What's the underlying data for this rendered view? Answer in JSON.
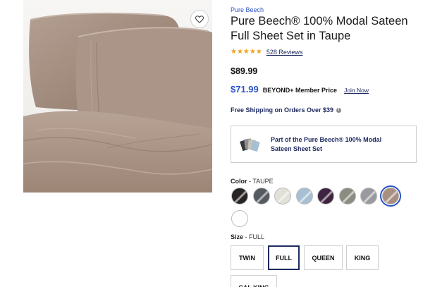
{
  "product": {
    "brand": "Pure Beech",
    "title": "Pure Beech® 100% Modal Sateen Full Sheet Set in Taupe",
    "rating_stars": "★★★★★",
    "rating_value": 4.5,
    "reviews_text": "528 Reviews",
    "price": "$89.99",
    "member_price": "$71.99",
    "member_label": "BEYOND+ Member Price",
    "join_label": "Join Now",
    "shipping_text": "Free Shipping on Orders Over $39",
    "info_icon": "i"
  },
  "set_card": {
    "text": "Part of the Pure Beech® 100% Modal Sateen Sheet Set",
    "icon": "sheet-set-thumbnail-icon"
  },
  "favorite": {
    "icon": "heart-icon"
  },
  "color_option": {
    "label": "Color",
    "separator": " - ",
    "value": "TAUPE",
    "selected_index": 7,
    "swatches": [
      {
        "name": "swatch-black",
        "color": "#2a2324"
      },
      {
        "name": "swatch-charcoal",
        "color": "#565a61"
      },
      {
        "name": "swatch-white-sand",
        "color": "#e3dfd9"
      },
      {
        "name": "swatch-light-blue",
        "color": "#a6bfd3"
      },
      {
        "name": "swatch-plum",
        "color": "#3e2440"
      },
      {
        "name": "swatch-sage",
        "color": "#8b8d81"
      },
      {
        "name": "swatch-grey",
        "color": "#9b99a0"
      },
      {
        "name": "swatch-taupe",
        "color": "#a88f80"
      },
      {
        "name": "swatch-white",
        "color": "#ffffff"
      }
    ]
  },
  "size_option": {
    "label": "Size",
    "separator": " - ",
    "value": "FULL",
    "buttons": [
      "TWIN",
      "FULL",
      "QUEEN",
      "KING",
      "CAL KING"
    ],
    "selected": "FULL"
  },
  "colors": {
    "accent_blue": "#2c53c9",
    "navy": "#1f2a60",
    "star": "#f0a21a"
  }
}
